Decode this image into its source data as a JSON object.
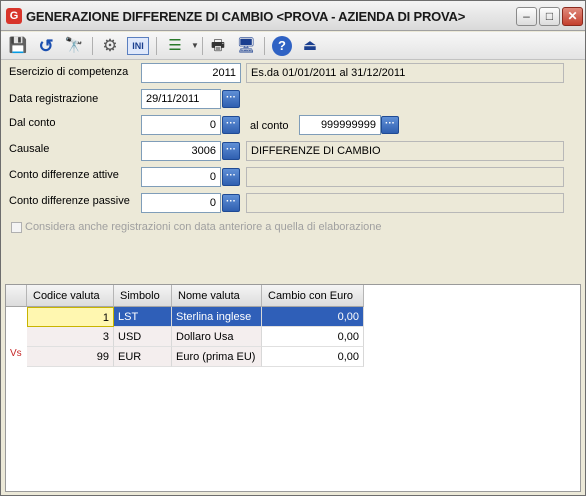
{
  "window": {
    "icon_letter": "G",
    "title": "GENERAZIONE DIFFERENZE DI CAMBIO <PROVA - AZIENDA DI PROVA>",
    "minimize": "–",
    "maximize": "□",
    "close": "✕"
  },
  "toolbar": {
    "save_icon": "💾",
    "undo_icon": "↺",
    "search_icon": "🔭",
    "gear_icon": "⚙",
    "ini_label": "INI",
    "list_icon": "☰",
    "print_icon": "🖶",
    "monitor_icon": "🖥",
    "help_icon": "?",
    "exit_icon": "⏏"
  },
  "form": {
    "esercizio_label": "Esercizio di competenza",
    "esercizio_value": "2011",
    "esercizio_desc": "Es.da 01/01/2011 al 31/12/2011",
    "data_label": "Data registrazione",
    "data_value": "29/11/2011",
    "dal_conto_label": "Dal conto",
    "dal_conto_value": "0",
    "al_conto_label": "al conto",
    "al_conto_value": "999999999",
    "causale_label": "Causale",
    "causale_value": "3006",
    "causale_desc": "DIFFERENZE DI CAMBIO",
    "attive_label": "Conto differenze attive",
    "attive_value": "0",
    "attive_desc": "",
    "passive_label": "Conto differenze passive",
    "passive_value": "0",
    "passive_desc": "",
    "dots": "···",
    "considera_label": "Considera anche registrazioni con data anteriore a quella di elaborazione"
  },
  "grid": {
    "columns": [
      "Codice valuta",
      "Simbolo",
      "Nome valuta",
      "Cambio con Euro"
    ],
    "row_indicator": "Vs",
    "rows": [
      {
        "codice": "1",
        "simbolo": "LST",
        "nome": "Sterlina inglese",
        "cambio": "0,00"
      },
      {
        "codice": "3",
        "simbolo": "USD",
        "nome": "Dollaro Usa",
        "cambio": "0,00"
      },
      {
        "codice": "99",
        "simbolo": "EUR",
        "nome": "Euro (prima EU)",
        "cambio": "0,00"
      }
    ]
  },
  "colors": {
    "selected_row": "#2f5fb8",
    "active_cell": "#fff7b0",
    "alt_row": "#f4eeee"
  }
}
